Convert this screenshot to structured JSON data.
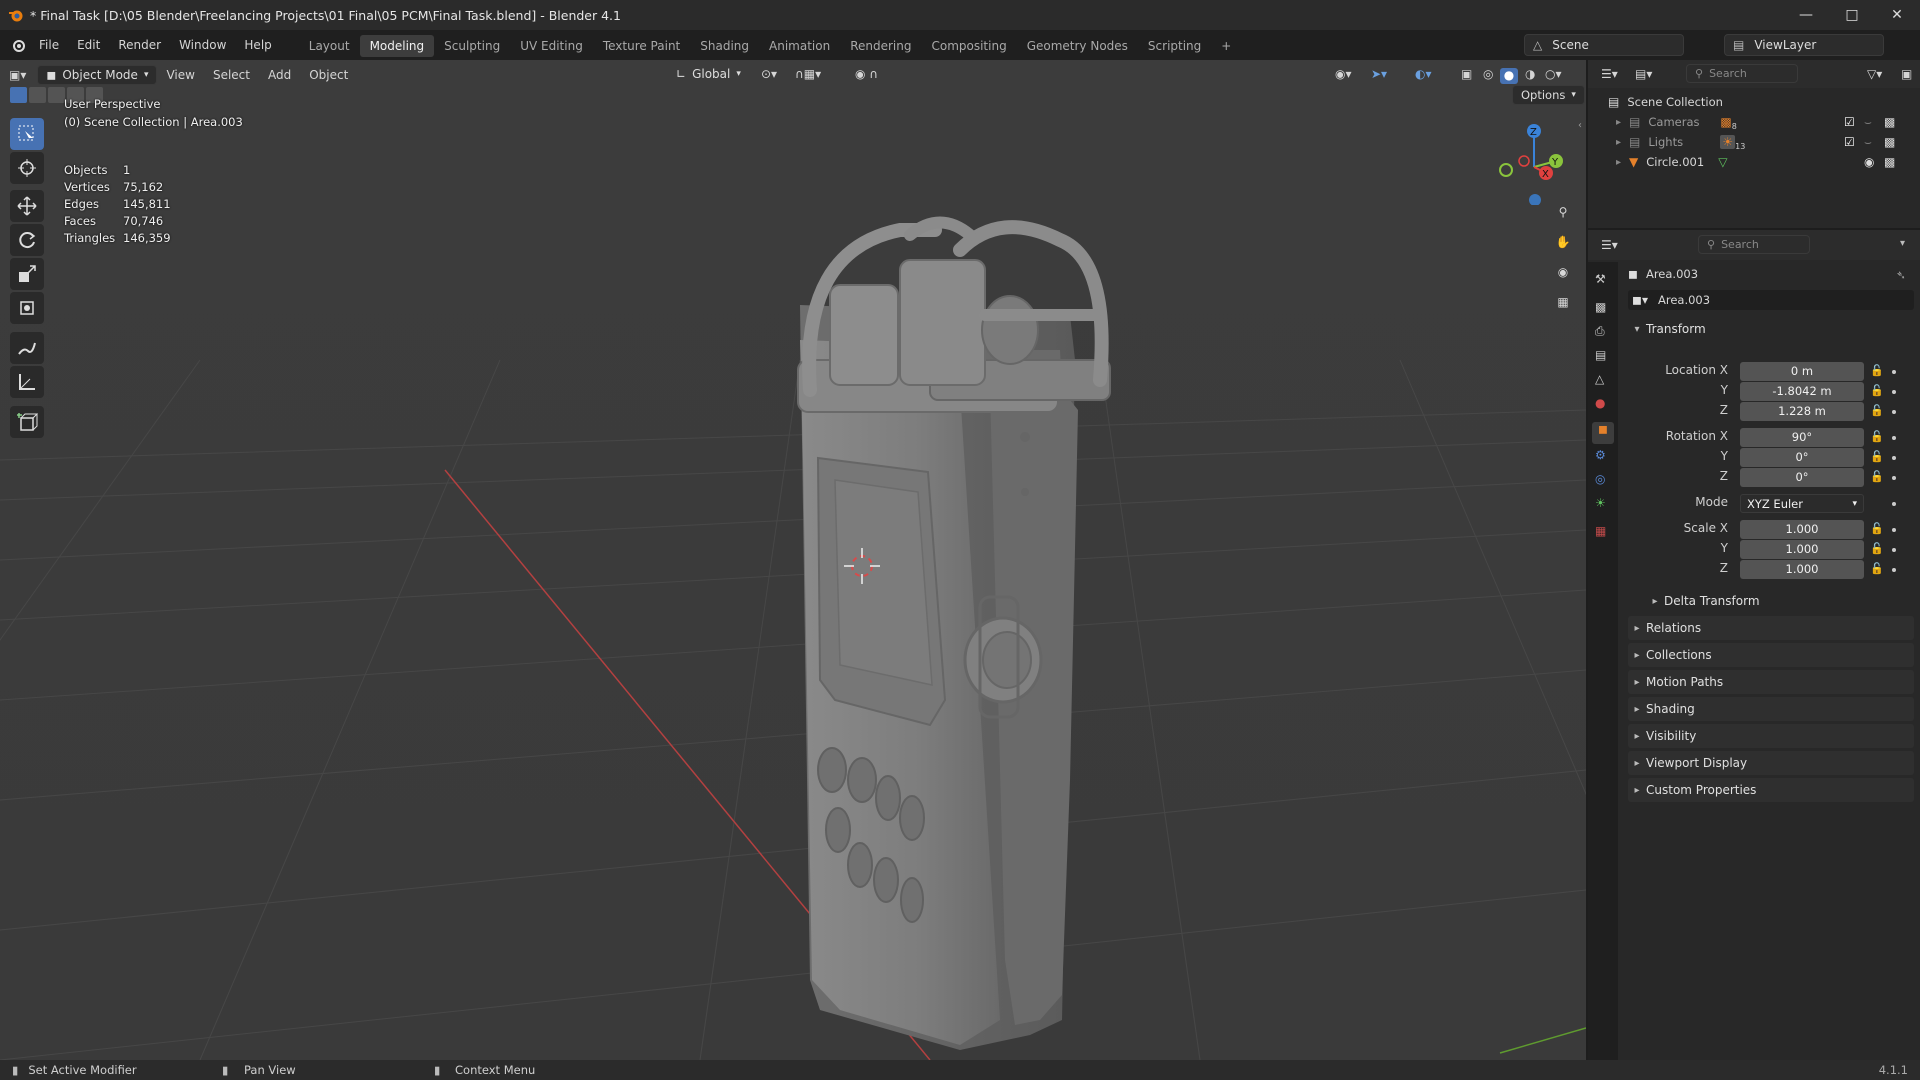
{
  "window": {
    "title": "* Final Task [D:\\05 Blender\\Freelancing Projects\\01 Final\\05 PCM\\Final Task.blend] - Blender 4.1"
  },
  "menu": [
    "File",
    "Edit",
    "Render",
    "Window",
    "Help"
  ],
  "workspaces": [
    "Layout",
    "Modeling",
    "Sculpting",
    "UV Editing",
    "Texture Paint",
    "Shading",
    "Animation",
    "Rendering",
    "Compositing",
    "Geometry Nodes",
    "Scripting"
  ],
  "active_workspace": "Modeling",
  "scene": {
    "name": "Scene",
    "view_layer": "ViewLayer"
  },
  "viewport": {
    "mode": "Object Mode",
    "menus": [
      "View",
      "Select",
      "Add",
      "Object"
    ],
    "orientation": "Global",
    "options": "Options",
    "overlay_title": "User Perspective",
    "overlay_sub": "(0) Scene Collection | Area.003",
    "stats": [
      {
        "k": "Objects",
        "v": "1"
      },
      {
        "k": "Vertices",
        "v": "75,162"
      },
      {
        "k": "Edges",
        "v": "145,811"
      },
      {
        "k": "Faces",
        "v": "70,746"
      },
      {
        "k": "Triangles",
        "v": "146,359"
      }
    ],
    "gizmo": {
      "x": "X",
      "y": "Y",
      "z": "Z"
    }
  },
  "outliner": {
    "search_placeholder": "Search",
    "root": "Scene Collection",
    "items": [
      {
        "label": "Cameras",
        "count": "8"
      },
      {
        "label": "Lights",
        "count": "13"
      },
      {
        "label": "Circle.001",
        "count": ""
      }
    ]
  },
  "properties": {
    "search_placeholder": "Search",
    "object": "Area.003",
    "data_name": "Area.003",
    "transform_title": "Transform",
    "location_label": "Location X",
    "location": [
      "0 m",
      "-1.8042 m",
      "1.228 m"
    ],
    "rotation_label": "Rotation X",
    "rotation": [
      "90°",
      "0°",
      "0°"
    ],
    "mode_label": "Mode",
    "mode": "XYZ Euler",
    "scale_label": "Scale X",
    "scale": [
      "1.000",
      "1.000",
      "1.000"
    ],
    "axis_y": "Y",
    "axis_z": "Z",
    "delta": "Delta Transform",
    "panels": [
      "Relations",
      "Collections",
      "Motion Paths",
      "Shading",
      "Visibility",
      "Viewport Display",
      "Custom Properties"
    ]
  },
  "status": {
    "left": "Set Active Modifier",
    "middle": "Pan View",
    "right": "Context Menu",
    "version": "4.1.1"
  },
  "colors": {
    "accent": "#4772b3",
    "object_orange": "#e5812b",
    "x_axis": "#e0413f",
    "y_axis": "#8ac43c",
    "z_axis": "#3a83d9"
  }
}
